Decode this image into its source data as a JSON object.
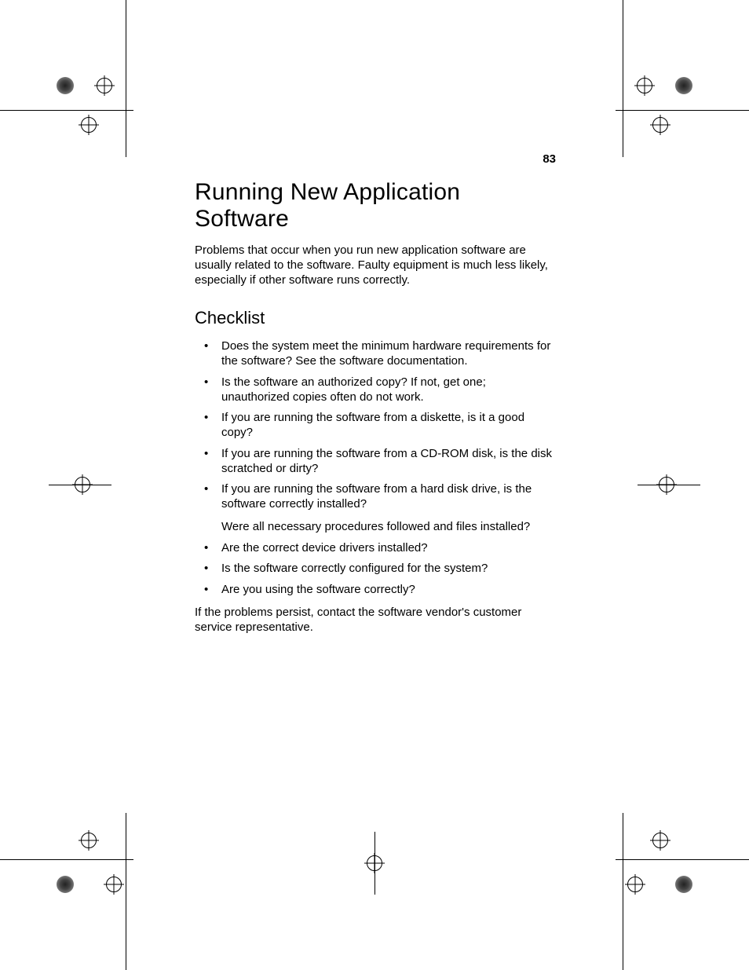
{
  "page_number": "83",
  "title": "Running New Application Software",
  "intro": "Problems that occur when you run new application software are usually related to the software. Faulty equipment is much less likely, especially if other software runs correctly.",
  "subhead": "Checklist",
  "checklist": [
    "Does the system meet the minimum hardware requirements for the software? See the software documentation.",
    "Is the software an authorized copy? If not, get one; unauthorized copies often do not work.",
    "If you are running the software from a diskette, is it a good copy?",
    "If you are running the software from a CD-ROM disk, is the disk scratched or dirty?",
    "If you are running the software from a hard disk drive, is the software correctly installed?",
    "Are the correct device drivers installed?",
    "Is the software correctly configured for the system?",
    "Are you using the software correctly?"
  ],
  "checklist_sub_5": "Were all necessary procedures followed and files installed?",
  "closing": "If the problems persist, contact the software vendor's customer service representative."
}
